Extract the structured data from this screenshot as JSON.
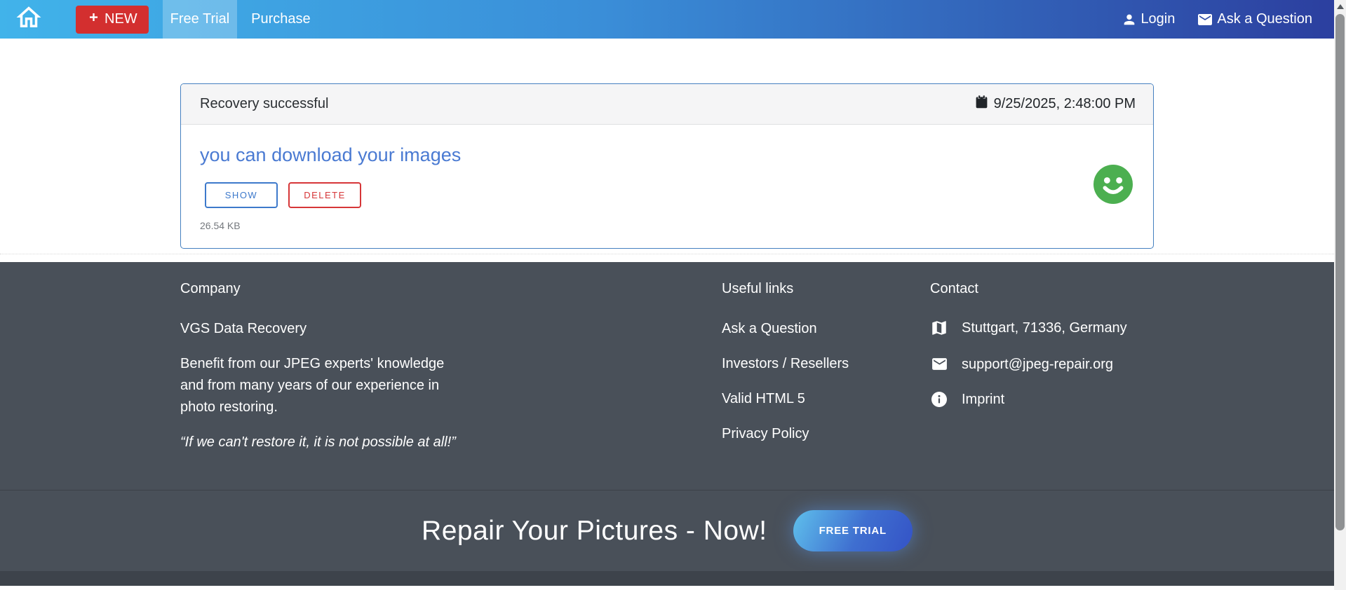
{
  "navbar": {
    "new_label": "NEW",
    "tabs": {
      "free_trial": "Free Trial",
      "purchase": "Purchase"
    },
    "login_label": "Login",
    "ask_label": "Ask a Question"
  },
  "card": {
    "title": "Recovery successful",
    "timestamp": "9/25/2025, 2:48:00 PM",
    "message": "you can download your images",
    "show_label": "SHOW",
    "delete_label": "DELETE",
    "file_size": "26.54 KB"
  },
  "footer": {
    "company": {
      "heading": "Company",
      "name": "VGS Data Recovery",
      "description": "Benefit from our JPEG experts' knowledge and from many years of our experience in photo restoring.",
      "quote": "“If we can't restore it, it is not possible at all!”"
    },
    "useful_links": {
      "heading": "Useful links",
      "links": [
        "Ask a Question",
        "Investors / Resellers",
        "Valid HTML 5",
        "Privacy Policy"
      ]
    },
    "contact": {
      "heading": "Contact",
      "location": "Stuttgart, 71336, Germany",
      "email": "support@jpeg-repair.org",
      "imprint": "Imprint"
    },
    "cta": {
      "heading": "Repair Your Pictures - Now!",
      "button_label": "FREE TRIAL"
    }
  },
  "icons": {
    "home": "home-icon",
    "plus": "plus-icon",
    "person": "person-icon",
    "envelope": "envelope-icon",
    "calendar": "calendar-icon",
    "smiley": "smiley-face-icon",
    "map": "map-icon",
    "info": "info-circle-icon",
    "scroll_up": "scroll-up-arrow-icon"
  },
  "colors": {
    "navbar_gradient_start": "#41b3ea",
    "navbar_gradient_end": "#2c3f9f",
    "new_button_red": "#d32f2f",
    "card_border_blue": "#4580c0",
    "message_blue": "#4a7ad2",
    "show_blue": "#3d79cb",
    "delete_red": "#d63638",
    "smiley_green": "#4caf50",
    "footer_bg": "#495059",
    "bottom_bar_bg": "#3d434b"
  }
}
